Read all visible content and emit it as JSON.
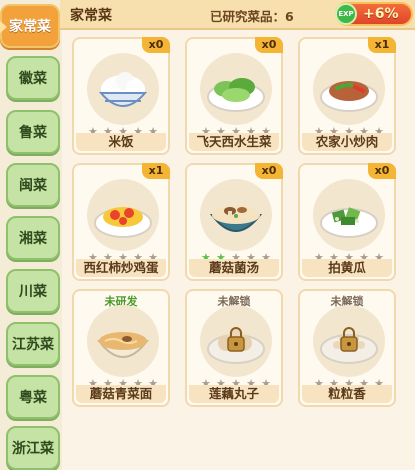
{
  "sidebar": {
    "tabs": [
      {
        "label": "家常菜",
        "active": true
      },
      {
        "label": "徽菜"
      },
      {
        "label": "鲁菜"
      },
      {
        "label": "闽菜"
      },
      {
        "label": "湘菜"
      },
      {
        "label": "川菜"
      },
      {
        "label": "江苏菜"
      },
      {
        "label": "粤菜"
      },
      {
        "label": "浙江菜"
      }
    ]
  },
  "header": {
    "title": "家常菜",
    "researched": "已研究菜品：6",
    "exp_icon": "EXP",
    "exp_bonus": "+6%"
  },
  "dishes": [
    {
      "name": "米饭",
      "badge": "x0",
      "stars_lit": 0
    },
    {
      "name": "飞天西水生菜",
      "badge": "x0",
      "stars_lit": 0
    },
    {
      "name": "农家小炒肉",
      "badge": "x1",
      "stars_lit": 0
    },
    {
      "name": "西红柿炒鸡蛋",
      "badge": "x1",
      "stars_lit": 0
    },
    {
      "name": "蘑菇菌汤",
      "badge": "x0",
      "stars_lit": 2
    },
    {
      "name": "拍黄瓜",
      "badge": "x0",
      "stars_lit": 0
    },
    {
      "name": "蘑菇青菜面",
      "tag": "未研发",
      "stars_lit": 0
    },
    {
      "name": "莲藕丸子",
      "tag": "未解锁",
      "stars_lit": 0
    },
    {
      "name": "粒粒香",
      "tag": "未解锁",
      "stars_lit": 0
    }
  ],
  "colors": {
    "active_tab": "#f3a13a",
    "inactive_tab": "#c5e3a4",
    "badge": "#f4b434",
    "exp_pill": "#e0462a"
  }
}
